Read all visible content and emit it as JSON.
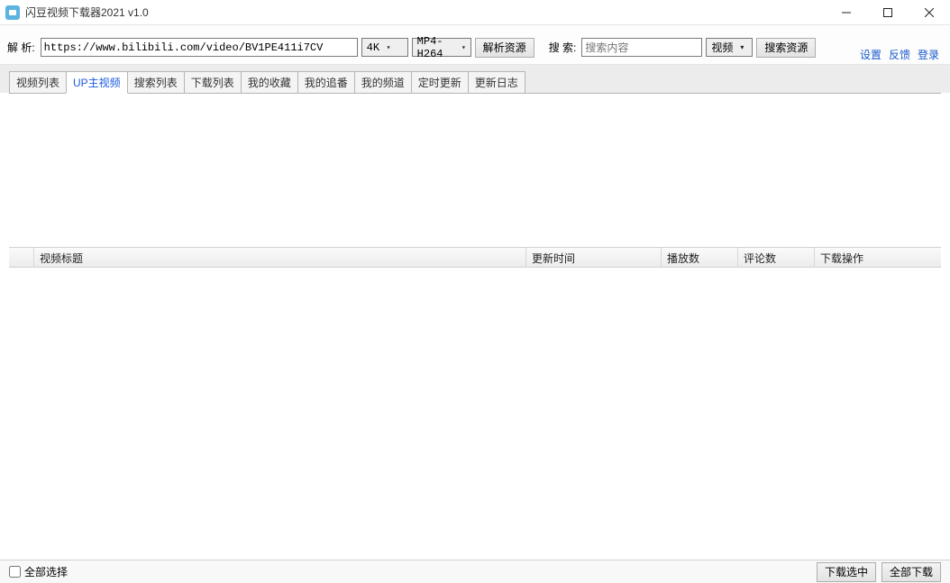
{
  "window": {
    "title": "闪豆视频下载器2021 v1.0"
  },
  "toolbar": {
    "parse_label": "解 析:",
    "url_value": "https://www.bilibili.com/video/BV1PE411i7CV",
    "quality": "4K",
    "format": "MP4-H264",
    "parse_button": "解析资源",
    "search_label": "搜 索:",
    "search_placeholder": "搜索内容",
    "search_type": "视频",
    "search_button": "搜索资源"
  },
  "links": {
    "settings": "设置",
    "feedback": "反馈",
    "login": "登录"
  },
  "tabs": [
    "视频列表",
    "UP主视频",
    "搜索列表",
    "下载列表",
    "我的收藏",
    "我的追番",
    "我的频道",
    "定时更新",
    "更新日志"
  ],
  "active_tab_index": 1,
  "table": {
    "columns": {
      "title": "视频标题",
      "update_time": "更新时间",
      "plays": "播放数",
      "comments": "评论数",
      "action": "下载操作"
    },
    "rows": []
  },
  "footer": {
    "select_all": "全部选择",
    "download_selected": "下载选中",
    "download_all": "全部下载"
  }
}
